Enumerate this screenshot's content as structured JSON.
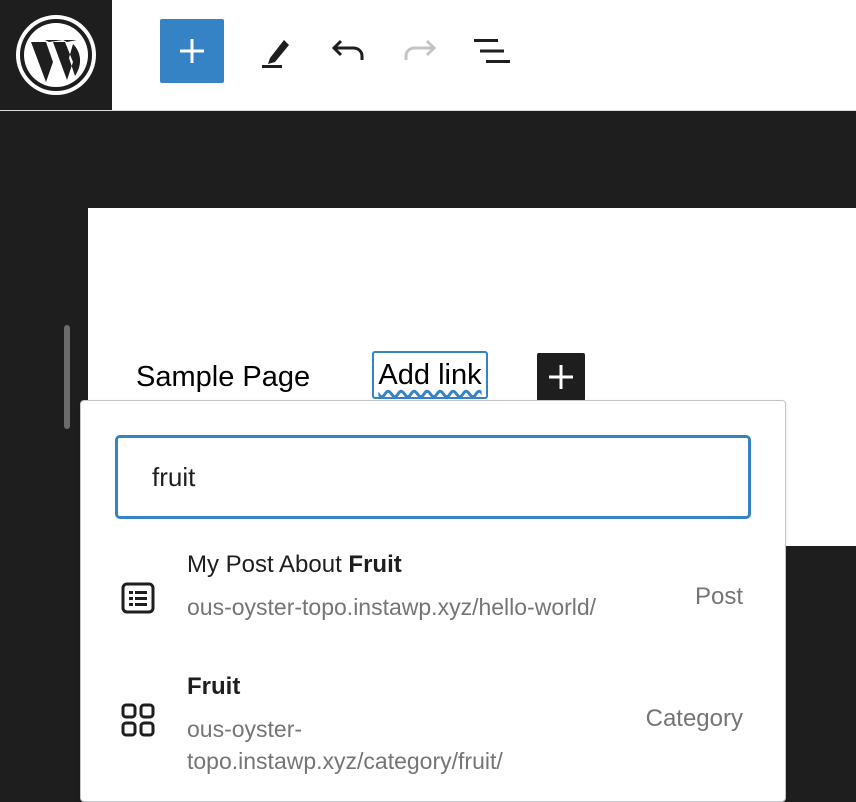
{
  "toolbar": {
    "logo_icon": "wordpress-logo-icon",
    "buttons": [
      {
        "name": "add-block-button",
        "icon": "plus-icon"
      },
      {
        "name": "tools-button",
        "icon": "pencil-icon"
      },
      {
        "name": "undo-button",
        "icon": "undo-icon"
      },
      {
        "name": "redo-button",
        "icon": "redo-icon"
      },
      {
        "name": "document-overview-button",
        "icon": "list-view-icon"
      }
    ],
    "accent_color": "#3582c4"
  },
  "navigation": {
    "items": [
      {
        "label": "Sample Page"
      },
      {
        "label": "Add link"
      }
    ]
  },
  "link_popover": {
    "search_value": "fruit",
    "results": [
      {
        "title_prefix": "My Post About ",
        "title_match": "Fruit",
        "url": "ous-oyster-topo.instawp.xyz/hello-world/",
        "type": "Post",
        "icon": "post-list-icon"
      },
      {
        "title_prefix": "",
        "title_match": "Fruit",
        "url": "ous-oyster-topo.instawp.xyz/category/fruit/",
        "type": "Category",
        "icon": "category-grid-icon"
      }
    ]
  }
}
